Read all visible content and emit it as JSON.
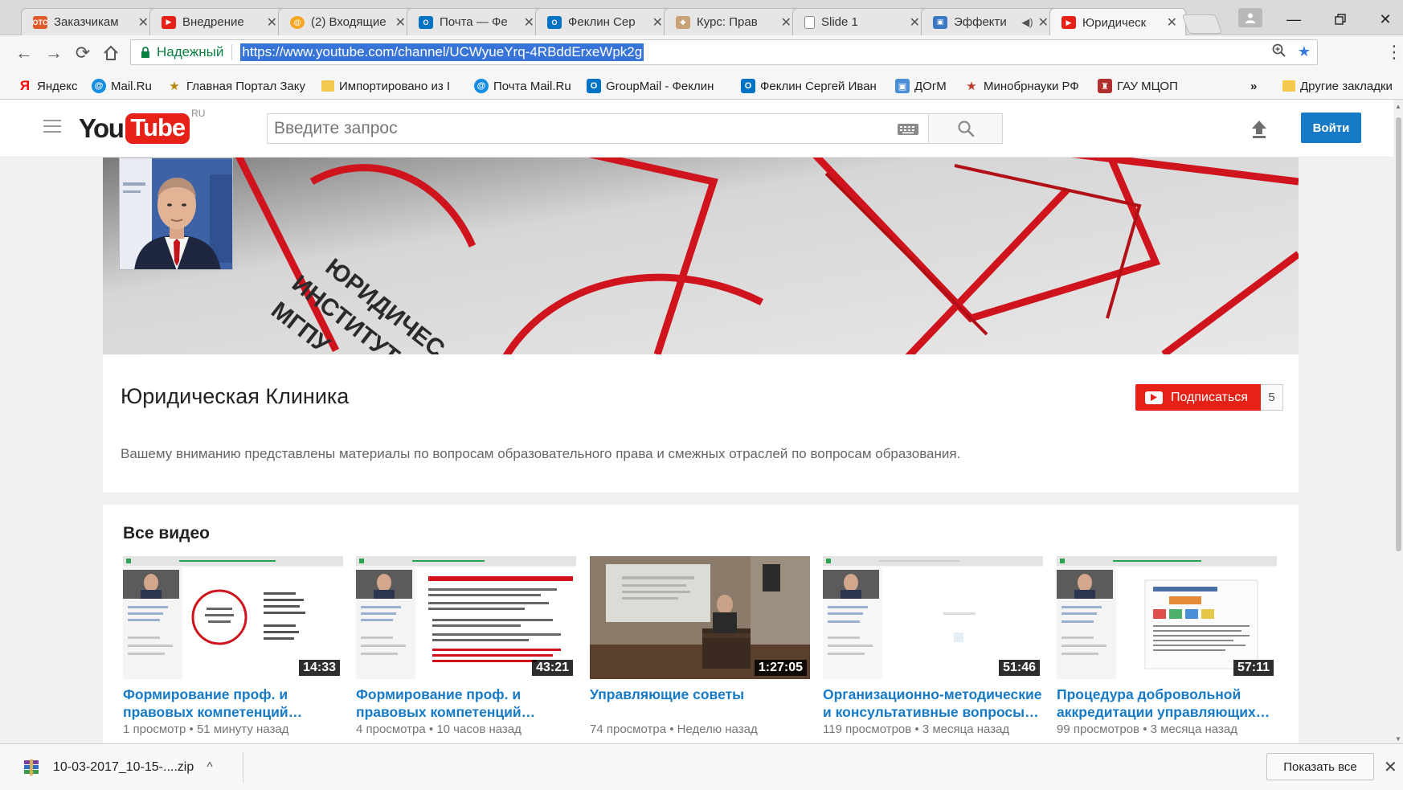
{
  "browser": {
    "tabs": [
      {
        "title": "Заказчикам",
        "favicon": "otc-icon",
        "favicon_text": "ОТС",
        "color": "#e05a2a"
      },
      {
        "title": "Внедрение",
        "favicon": "youtube-icon",
        "color": "#e62117"
      },
      {
        "title": "(2) Входящие",
        "favicon": "mailru-icon",
        "color": "#1a6fbd"
      },
      {
        "title": "Почта — Фе",
        "favicon": "outlook-icon",
        "favicon_text": "O",
        "color": "#0072c6"
      },
      {
        "title": "Феклин Сер",
        "favicon": "outlook-icon",
        "favicon_text": "O",
        "color": "#0072c6"
      },
      {
        "title": "Курс: Прав",
        "favicon": "moodle-icon",
        "color": "#c9a27a"
      },
      {
        "title": "Slide 1",
        "favicon": "page-icon",
        "color": "#888888"
      },
      {
        "title": "Эффекти",
        "favicon": "slides-icon",
        "color": "#3b78c4",
        "muted_icon": true
      },
      {
        "title": "Юридическ",
        "favicon": "youtube-icon",
        "color": "#e62117",
        "active": true
      }
    ],
    "address": {
      "secure_label": "Надежный",
      "url": "https://www.youtube.com/channel/UCWyueYrq-4RBddErxeWpk2g"
    },
    "bookmarks": [
      {
        "label": "Яндекс",
        "icon": "yandex-icon",
        "icon_text": "Я",
        "color": "#ff0000"
      },
      {
        "label": "Mail.Ru",
        "icon": "mailru-icon",
        "icon_text": "@",
        "color": "#168de2"
      },
      {
        "label": "Главная Портал Заку",
        "icon": "emblem-icon",
        "icon_text": "★",
        "color": "#b8860b"
      },
      {
        "label": "Импортировано из I",
        "icon": "folder-icon",
        "icon_text": "",
        "color": "#f2c94c"
      },
      {
        "label": "Почта Mail.Ru",
        "icon": "mailru-icon",
        "icon_text": "@",
        "color": "#168de2"
      },
      {
        "label": "GroupMail - Феклин",
        "icon": "outlook-icon",
        "icon_text": "O",
        "color": "#0072c6"
      },
      {
        "label": "Феклин Сергей Иван",
        "icon": "outlook-icon",
        "icon_text": "O",
        "color": "#0072c6"
      },
      {
        "label": "ДОгМ",
        "icon": "image-icon",
        "icon_text": "▣",
        "color": "#4a8fd6"
      },
      {
        "label": "Минобрнауки РФ",
        "icon": "emblem-icon",
        "icon_text": "★",
        "color": "#c0392b"
      },
      {
        "label": "ГАУ МЦОП",
        "icon": "emblem-icon",
        "icon_text": "♜",
        "color": "#b03030"
      }
    ],
    "bookmarks_overflow": "»",
    "other_bookmarks": "Другие закладки"
  },
  "youtube": {
    "logo_you": "You",
    "logo_tube": "Tube",
    "country": "RU",
    "search_placeholder": "Введите запрос",
    "signin_label": "Войти",
    "channel": {
      "title": "Юридическая Клиника",
      "subscribe_label": "Подписаться",
      "subscriber_count": "5",
      "description": "Вашему вниманию представлены материалы по вопросам образовательного права и смежных отраслей по вопросам образования.",
      "banner_text": [
        "ЮРИДИЧЕС",
        "ИНСТИТУТ",
        "МГПУ"
      ]
    },
    "section_title": "Все видео",
    "videos": [
      {
        "title": "Формирование проф. и правовых компетенций…",
        "views": "1 просмотр",
        "age": "51 минуту назад",
        "duration": "14:33"
      },
      {
        "title": "Формирование проф. и правовых компетенций…",
        "views": "4 просмотра",
        "age": "10 часов назад",
        "duration": "43:21"
      },
      {
        "title": "Управляющие советы",
        "views": "74 просмотра",
        "age": "Неделю назад",
        "duration": "1:27:05"
      },
      {
        "title": "Организационно-методические и консультативные вопросы…",
        "views": "119 просмотров",
        "age": "3 месяца назад",
        "duration": "51:46"
      },
      {
        "title": "Процедура добровольной аккредитации управляющих…",
        "views": "99 просмотров",
        "age": "3 месяца назад",
        "duration": "57:11"
      }
    ],
    "meta_separator": "•"
  },
  "downloads": {
    "file_name": "10-03-2017_10-15-....zip",
    "show_all_label": "Показать все"
  },
  "colors": {
    "youtube_red": "#e62117",
    "link_blue": "#167ac6",
    "url_highlight": "#3874d8"
  }
}
